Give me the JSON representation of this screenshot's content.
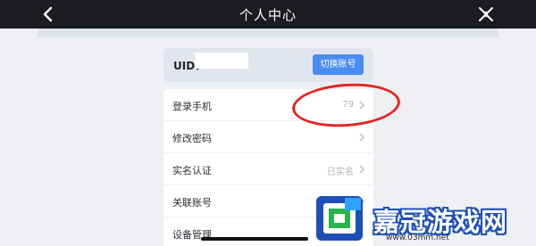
{
  "header": {
    "title": "个人中心",
    "back_icon": "back-arrow-icon",
    "close_icon": "star-close-icon"
  },
  "uid_card": {
    "label": "UID：",
    "value": "",
    "switch_label": "切换账号"
  },
  "menu": {
    "items": [
      {
        "label": "登录手机",
        "value": "79"
      },
      {
        "label": "修改密码",
        "value": ""
      },
      {
        "label": "实名认证",
        "value": "已实名"
      },
      {
        "label": "关联账号",
        "value": ""
      },
      {
        "label": "设备管理",
        "value": ""
      }
    ]
  },
  "watermark": {
    "brand": "嘉冠游戏网",
    "url": "www.03mm.net"
  },
  "colors": {
    "topbar": "#1b1c1f",
    "accent": "#4a8df0",
    "annotation": "#e3251f"
  }
}
